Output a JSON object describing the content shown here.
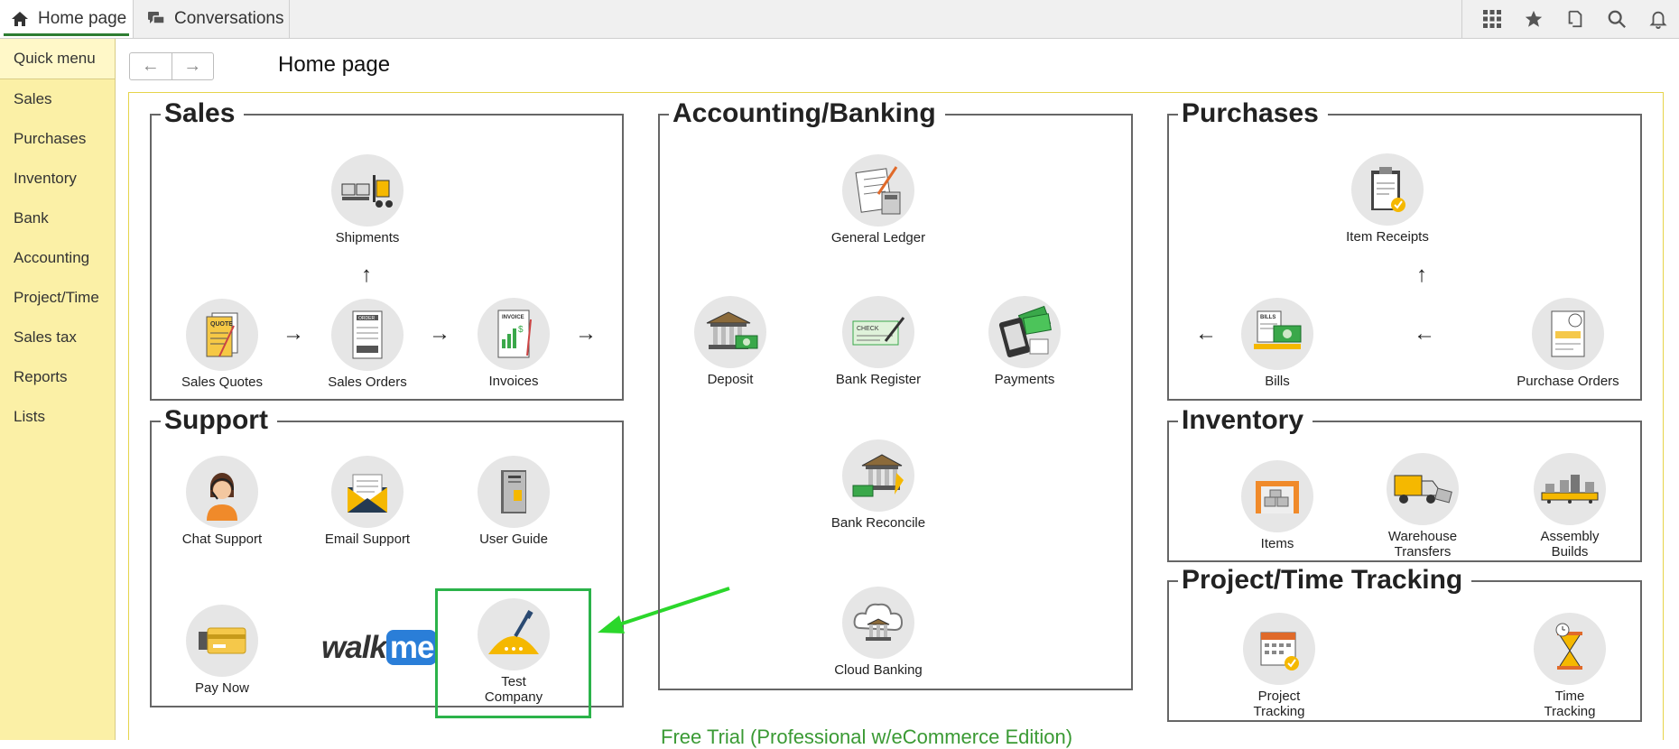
{
  "tabs": {
    "home": "Home page",
    "conversations": "Conversations"
  },
  "sidebar": {
    "quick_menu": "Quick menu",
    "items": [
      {
        "label": "Sales"
      },
      {
        "label": "Purchases"
      },
      {
        "label": "Inventory"
      },
      {
        "label": "Bank"
      },
      {
        "label": "Accounting"
      },
      {
        "label": "Project/Time"
      },
      {
        "label": "Sales tax"
      },
      {
        "label": "Reports"
      },
      {
        "label": "Lists"
      }
    ]
  },
  "header": {
    "title": "Home page"
  },
  "panels": {
    "sales": {
      "title": "Sales",
      "shipments": "Shipments",
      "sales_quotes": "Sales Quotes",
      "sales_orders": "Sales Orders",
      "invoices": "Invoices"
    },
    "support": {
      "title": "Support",
      "chat_support": "Chat Support",
      "email_support": "Email Support",
      "user_guide": "User Guide",
      "pay_now": "Pay Now",
      "walkme_walk": "walk",
      "walkme_me": "me",
      "test_company_line1": "Test",
      "test_company_line2": "Company"
    },
    "accounting": {
      "title": "Accounting/Banking",
      "general_ledger": "General Ledger",
      "deposit": "Deposit",
      "bank_register": "Bank Register",
      "payments": "Payments",
      "bank_reconcile": "Bank Reconcile",
      "cloud_banking": "Cloud Banking"
    },
    "purchases": {
      "title": "Purchases",
      "item_receipts": "Item Receipts",
      "bills": "Bills",
      "purchase_orders": "Purchase Orders"
    },
    "inventory": {
      "title": "Inventory",
      "items": "Items",
      "warehouse_line1": "Warehouse",
      "warehouse_line2": "Transfers",
      "assembly_line1": "Assembly",
      "assembly_line2": "Builds"
    },
    "project": {
      "title": "Project/Time Tracking",
      "project_line1": "Project",
      "project_line2": "Tracking",
      "time_line1": "Time",
      "time_line2": "Tracking"
    }
  },
  "footer": {
    "free_trial": "Free Trial (Professional w/eCommerce Edition)"
  },
  "colors": {
    "sidebar_bg": "#fbf0a6",
    "highlight": "#2bb34a",
    "free_trial_text": "#3a9a34",
    "panel_border": "#666666"
  },
  "icons": {
    "home_tab": "home-icon",
    "conversations_tab": "chat-bubbles-icon",
    "top_right": [
      "apps-grid-icon",
      "star-icon",
      "copy-icon",
      "search-icon",
      "bell-icon"
    ]
  }
}
